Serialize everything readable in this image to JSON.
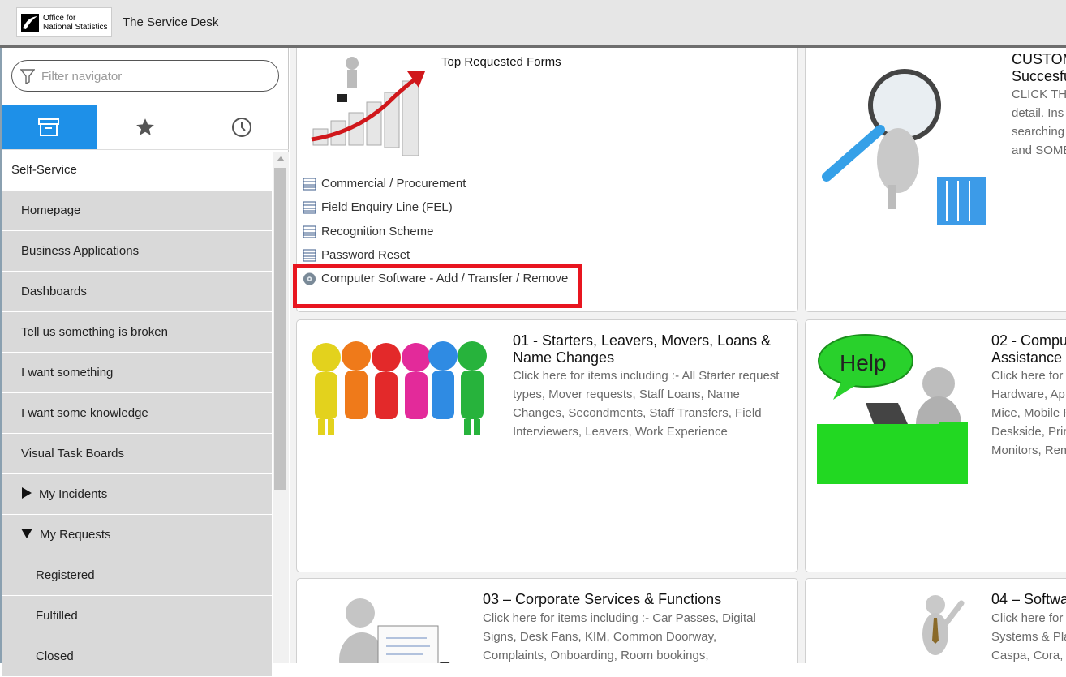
{
  "app": {
    "logo_line1": "Office for",
    "logo_line2": "National Statistics",
    "title": "The Service Desk"
  },
  "navigator": {
    "filter_placeholder": "Filter navigator",
    "tabs": [
      {
        "icon": "archive-icon",
        "active": true
      },
      {
        "icon": "star-icon",
        "active": false
      },
      {
        "icon": "clock-icon",
        "active": false
      }
    ],
    "section": "Self-Service",
    "items": [
      {
        "label": "Homepage"
      },
      {
        "label": "Business Applications"
      },
      {
        "label": "Dashboards"
      },
      {
        "label": "Tell us something is broken"
      },
      {
        "label": "I want something"
      },
      {
        "label": "I want some knowledge"
      },
      {
        "label": "Visual Task Boards"
      },
      {
        "label": "My Incidents",
        "expander": "collapsed"
      },
      {
        "label": "My Requests",
        "expander": "expanded"
      },
      {
        "label": "Registered",
        "sub": true
      },
      {
        "label": "Fulfilled",
        "sub": true
      },
      {
        "label": "Closed",
        "sub": true
      }
    ]
  },
  "top_forms": {
    "title": "Top Requested Forms",
    "links": [
      {
        "label": "Commercial / Procurement",
        "icon": "form-icon"
      },
      {
        "label": "Field Enquiry Line (FEL)",
        "icon": "form-icon"
      },
      {
        "label": "Recognition Scheme",
        "icon": "form-icon"
      },
      {
        "label": "Password Reset",
        "icon": "form-icon"
      },
      {
        "label": "Computer Software - Add / Transfer / Remove",
        "icon": "disc-icon"
      }
    ]
  },
  "cards": {
    "customer": {
      "title_line1": "CUSTOM",
      "title_line2": "Succesfu",
      "desc": [
        "CLICK THI",
        "detail. Ins",
        "searching",
        "and SOME"
      ]
    },
    "c01": {
      "title": "01 - Starters, Leavers, Movers, Loans & Name Changes",
      "desc": "Click here for items including :- All Starter request types, Mover requests, Staff Loans, Name Changes, Secondments, Staff Transfers, Field Interviewers, Leavers, Work Experience"
    },
    "c02": {
      "title_line1": "02 - Compu",
      "title_line2": "Assistance",
      "help_text": "Help",
      "desc": [
        "Click here for",
        "Hardware, Ap",
        "Mice, Mobile P",
        "Deskside, Prin",
        "Monitors, Rem"
      ]
    },
    "c03": {
      "title": "03 – Corporate Services & Functions",
      "desc": "Click here for items including :- Car Passes, Digital Signs, Desk Fans, KIM, Common Doorway, Complaints, Onboarding, Room bookings,"
    },
    "c04": {
      "title": "04 – Softwa",
      "desc": [
        "Click here for",
        "Systems & Pla",
        "Caspa, Cora, C"
      ]
    }
  }
}
